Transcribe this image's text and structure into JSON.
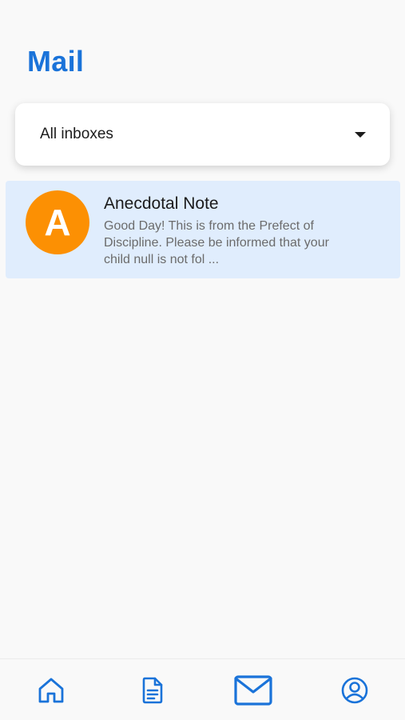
{
  "header": {
    "title": "Mail"
  },
  "filter": {
    "selected": "All inboxes"
  },
  "mail_list": [
    {
      "avatar_letter": "A",
      "subject": "Anecdotal Note",
      "preview": "Good Day! This is from the Prefect of Discipline. Please be informed that your child null is not fol ..."
    }
  ],
  "bottom_nav": {
    "items": [
      {
        "icon": "home-icon",
        "active": false
      },
      {
        "icon": "document-icon",
        "active": false
      },
      {
        "icon": "mail-icon",
        "active": true
      },
      {
        "icon": "profile-icon",
        "active": false
      }
    ]
  },
  "colors": {
    "accent": "#1a73d9",
    "avatar": "#fc9003",
    "selected_row": "#e0edfd"
  }
}
